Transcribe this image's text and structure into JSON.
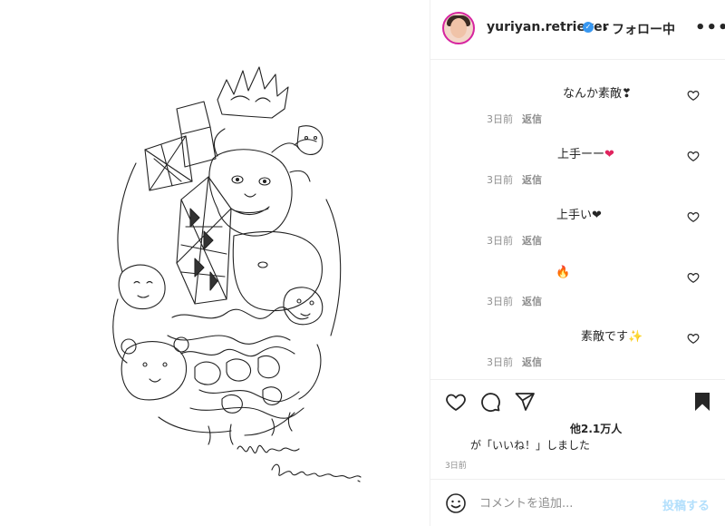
{
  "header": {
    "username": "yuriyan.retriever",
    "verified_icon": "verified-badge-icon",
    "follow_status": "・フォロー中",
    "more_icon": "more-options-icon"
  },
  "comments": [
    {
      "text": "なんか素敵",
      "emoji": "❣",
      "time": "3日前",
      "reply": "返信"
    },
    {
      "text": "上手ーー",
      "emoji": "❤",
      "time": "3日前",
      "reply": "返信"
    },
    {
      "text": "上手い",
      "emoji": "❤",
      "time": "3日前",
      "reply": "返信"
    },
    {
      "text": "",
      "emoji": "🔥",
      "time": "3日前",
      "reply": "返信"
    },
    {
      "text": "素敵です",
      "emoji": "✨",
      "time": "3日前",
      "reply": "返信"
    }
  ],
  "actions": {
    "like_icon": "heart-icon",
    "comment_icon": "comment-icon",
    "share_icon": "share-icon",
    "save_icon": "bookmark-icon"
  },
  "likes": {
    "count": "他2.1万人",
    "text": "が「いいね！」しました"
  },
  "post_date": "3日前",
  "add_comment": {
    "placeholder": "コメントを追加...",
    "post_label": "投稿する"
  },
  "media": {
    "signature_line1": "Yuriyan",
    "signature_line2": "Retriever"
  },
  "colors": {
    "accent": "#3897f0",
    "post_button_disabled": "#b2dffc",
    "text": "#262626",
    "muted": "#8e8e8e"
  }
}
